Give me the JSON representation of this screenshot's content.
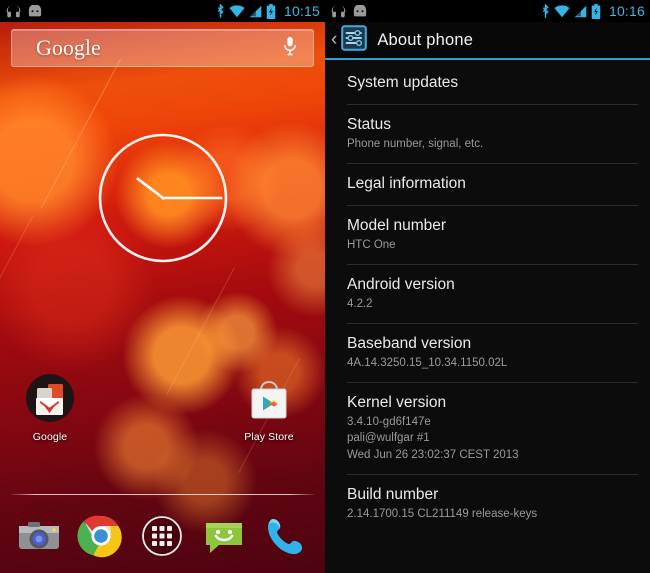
{
  "home": {
    "statusbar": {
      "notifications": [
        "headphones-icon",
        "android-robot-icon"
      ],
      "system_icons": [
        "bluetooth-icon",
        "wifi-icon",
        "signal-icon",
        "battery-charging-icon"
      ],
      "time": "10:15",
      "accent_color": "#33b5e5"
    },
    "search_widget": {
      "logo_text": "Google",
      "placeholder": "Google",
      "mic_icon": "microphone-icon"
    },
    "clock_widget": {
      "name": "analog-clock-widget",
      "displayed_time": "10:15",
      "hour_angle_deg": -52,
      "minute_angle_deg": 90
    },
    "app_icons": [
      {
        "name": "google-folder",
        "label": "Google",
        "icon": "gmail-folder-icon"
      },
      {
        "name": "play-store",
        "label": "Play Store",
        "icon": "play-store-icon"
      }
    ],
    "dock": [
      {
        "name": "camera",
        "icon": "camera-icon"
      },
      {
        "name": "chrome",
        "icon": "chrome-icon"
      },
      {
        "name": "app-drawer",
        "icon": "apps-grid-icon"
      },
      {
        "name": "messaging",
        "icon": "messaging-icon"
      },
      {
        "name": "phone",
        "icon": "phone-icon"
      }
    ]
  },
  "settings": {
    "statusbar": {
      "notifications": [
        "headphones-icon",
        "android-robot-icon"
      ],
      "system_icons": [
        "bluetooth-icon",
        "wifi-icon",
        "signal-icon",
        "battery-charging-icon"
      ],
      "time": "10:16",
      "accent_color": "#33b5e5"
    },
    "header": {
      "back_glyph": "‹",
      "icon": "settings-sliders-icon",
      "title": "About phone",
      "accent_color": "#2d9fd0"
    },
    "rows": [
      {
        "name": "system-updates",
        "title": "System updates",
        "sub": []
      },
      {
        "name": "status",
        "title": "Status",
        "sub": [
          "Phone number, signal, etc."
        ]
      },
      {
        "name": "legal-information",
        "title": "Legal information",
        "sub": []
      },
      {
        "name": "model-number",
        "title": "Model number",
        "sub": [
          "HTC One"
        ]
      },
      {
        "name": "android-version",
        "title": "Android version",
        "sub": [
          "4.2.2"
        ]
      },
      {
        "name": "baseband-version",
        "title": "Baseband version",
        "sub": [
          "4A.14.3250.15_10.34.1150.02L"
        ]
      },
      {
        "name": "kernel-version",
        "title": "Kernel version",
        "sub": [
          "3.4.10-gd6f147e",
          "pali@wulfgar #1",
          "Wed Jun 26 23:02:37 CEST 2013"
        ]
      },
      {
        "name": "build-number",
        "title": "Build number",
        "sub": [
          "2.14.1700.15 CL211149 release-keys"
        ]
      }
    ]
  }
}
